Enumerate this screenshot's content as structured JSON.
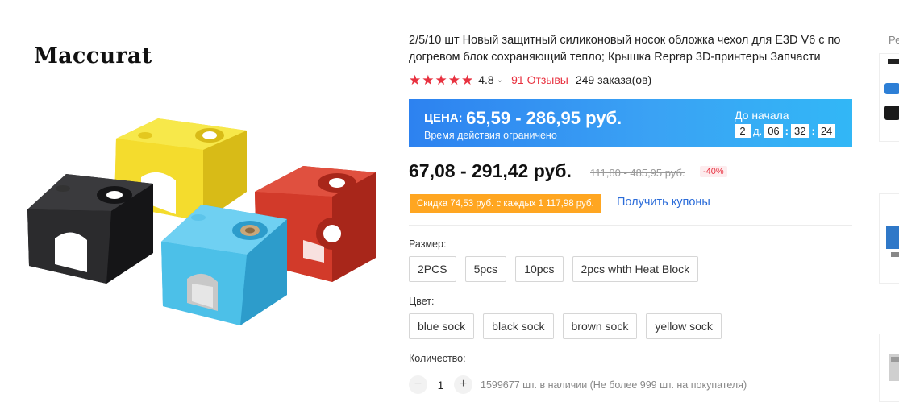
{
  "brand": {
    "name": "Maccurat"
  },
  "product": {
    "title": "2/5/10 шт Новый защитный силиконовый носок обложка чехол для E3D V6 с по догревом блок сохраняющий тепло; Крышка Reprap 3D-принтеры Запчасти",
    "rating": "4.8",
    "rating_chevron": "⌄",
    "reviews": "91 Отзывы",
    "orders": "249 заказа(ов)",
    "sock_colors": [
      "#2b2b2d",
      "#f4dc2d",
      "#d23a2a",
      "#4cc0e8"
    ]
  },
  "banner": {
    "price_label": "ЦЕНА:",
    "price_value": "65,59 - 286,95 руб.",
    "subtitle": "Время действия ограничено",
    "countdown_label": "До начала",
    "countdown": {
      "days": "2",
      "days_unit": "д.",
      "hours": "06",
      "minutes": "32",
      "seconds": "24"
    }
  },
  "price": {
    "current": "67,08 - 291,42 руб.",
    "old": "111,80 - 485,95 руб.",
    "discount": "-40%"
  },
  "coupon": {
    "tag": "Скидка 74,53 руб. с каждых 1 117,98 руб.",
    "link": "Получить купоны"
  },
  "size": {
    "label": "Размер:",
    "options": [
      "2PCS",
      "5pcs",
      "10pcs",
      "2pcs whth Heat Block"
    ]
  },
  "color": {
    "label": "Цвет:",
    "options": [
      "blue sock",
      "black sock",
      "brown sock",
      "yellow sock"
    ]
  },
  "quantity": {
    "label": "Количество:",
    "minus": "−",
    "value": "1",
    "plus": "+",
    "stock": "1599677 шт. в наличии (Не более 999 шт. на покупателя)"
  },
  "sidebar": {
    "header": "Ре"
  },
  "colors": {
    "accent_red": "#e8313f",
    "banner_blue": "#3aa2f4",
    "coupon_orange": "#ffa621",
    "link_blue": "#2b6cd9"
  }
}
